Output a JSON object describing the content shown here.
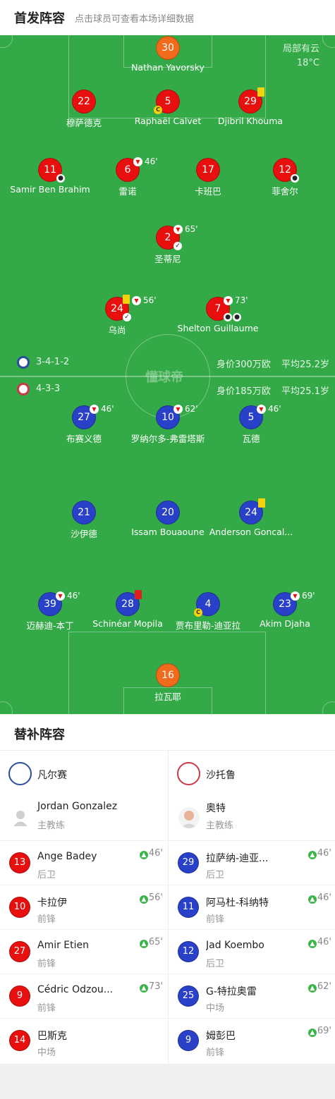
{
  "header": {
    "title": "首发阵容",
    "subtitle": "点击球员可查看本场详细数据"
  },
  "weather": {
    "condition": "局部有云",
    "temp": "18°C"
  },
  "home_team": {
    "formation": "3-4-1-2",
    "value": "身价300万欧",
    "avg_age": "平均25.2岁"
  },
  "away_team": {
    "formation": "4-3-3",
    "value": "身价185万欧",
    "avg_age": "平均25.1岁"
  },
  "watermark": "懂球帝",
  "home_players": [
    {
      "num": "30",
      "name": "Nathan Yavorsky"
    },
    {
      "num": "22",
      "name": "穆萨德克"
    },
    {
      "num": "5",
      "name": "Raphaël Calvet"
    },
    {
      "num": "29",
      "name": "Djibril Khouma"
    },
    {
      "num": "11",
      "name": "Samir Ben Brahim"
    },
    {
      "num": "6",
      "name": "雷诺",
      "sub": "46'"
    },
    {
      "num": "17",
      "name": "卡班巴"
    },
    {
      "num": "12",
      "name": "菲舍尔"
    },
    {
      "num": "2",
      "name": "圣蒂尼",
      "sub": "65'"
    },
    {
      "num": "24",
      "name": "乌尚",
      "sub": "56'"
    },
    {
      "num": "7",
      "name": "Shelton Guillaume",
      "sub": "73'"
    }
  ],
  "away_players": [
    {
      "num": "27",
      "name": "布赛义德",
      "sub": "46'"
    },
    {
      "num": "10",
      "name": "罗纳尔多-弗雷塔斯",
      "sub": "62'"
    },
    {
      "num": "5",
      "name": "瓦德",
      "sub": "46'"
    },
    {
      "num": "21",
      "name": "沙伊德"
    },
    {
      "num": "20",
      "name": "Issam Bouaoune"
    },
    {
      "num": "24",
      "name": "Anderson Goncal..."
    },
    {
      "num": "39",
      "name": "迈赫迪-本丁",
      "sub": "46'"
    },
    {
      "num": "28",
      "name": "Schinéar Mopila"
    },
    {
      "num": "4",
      "name": "贾布里勒-迪亚拉"
    },
    {
      "num": "23",
      "name": "Akim Djaha",
      "sub": "69'"
    },
    {
      "num": "16",
      "name": "拉瓦耶"
    }
  ],
  "bench": {
    "title": "替补阵容",
    "left": {
      "team": "凡尔赛",
      "coach": {
        "name": "Jordan Gonzalez",
        "role": "主教练"
      },
      "subs": [
        {
          "num": "13",
          "name": "Ange Badey",
          "pos": "后卫",
          "time": "46'"
        },
        {
          "num": "10",
          "name": "卡拉伊",
          "pos": "前锋",
          "time": "56'"
        },
        {
          "num": "27",
          "name": "Amir Etien",
          "pos": "前锋",
          "time": "65'"
        },
        {
          "num": "9",
          "name": "Cédric Odzou...",
          "pos": "前锋",
          "time": "73'"
        },
        {
          "num": "14",
          "name": "巴斯克",
          "pos": "中场",
          "time": ""
        }
      ]
    },
    "right": {
      "team": "沙托鲁",
      "coach": {
        "name": "奥特",
        "role": "主教练"
      },
      "subs": [
        {
          "num": "29",
          "name": "拉萨纳-迪亚...",
          "pos": "后卫",
          "time": "46'"
        },
        {
          "num": "11",
          "name": "阿马杜-科纳特",
          "pos": "前锋",
          "time": "46'"
        },
        {
          "num": "12",
          "name": "Jad Koembo",
          "pos": "后卫",
          "time": "46'"
        },
        {
          "num": "25",
          "name": "G-特拉奥雷",
          "pos": "中场",
          "time": "62'"
        },
        {
          "num": "9",
          "name": "姆彭巴",
          "pos": "前锋",
          "time": "69'"
        }
      ]
    }
  },
  "colors": {
    "pitch": "#33a947",
    "home": "#e8100f",
    "away": "#2940c8",
    "keeper": "#f26a1b"
  }
}
